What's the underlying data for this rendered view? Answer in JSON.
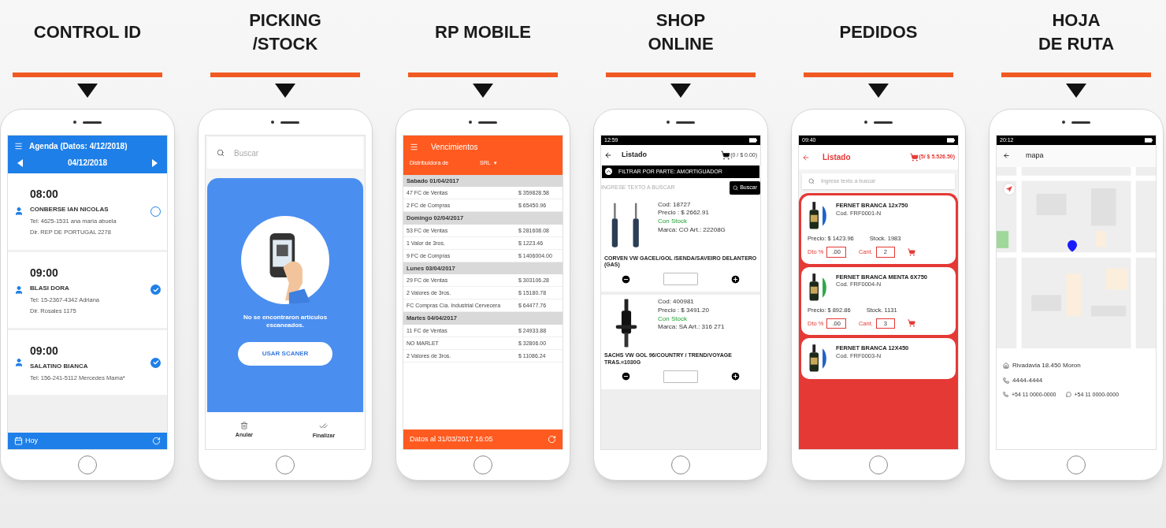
{
  "sections": [
    {
      "kind": "agenda",
      "title": "CONTROL ID",
      "screen": {
        "header_title": "Agenda (Datos: 4/12/2018)",
        "date": "04/12/2018",
        "appointments": [
          {
            "time": "08:00",
            "name": "CONBERSE IAN NICOLAS",
            "tel": "Tel: 4625-1531 ana maria abuela",
            "dir": "Dir. REP DE PORTUGAL 2278",
            "checked": false
          },
          {
            "time": "09:00",
            "name": "BLASI DORA",
            "tel": "Tel: 15-2367-4342 Adriana",
            "dir": "Dir. Rosales 1175",
            "checked": true
          },
          {
            "time": "09:00",
            "name": "SALATINO BIANCA",
            "tel": "Tel: 156-241-5112 Mercedes Mama*",
            "checked": true
          }
        ],
        "footer": "Hoy"
      }
    },
    {
      "kind": "picking",
      "title": "PICKING\n/STOCK",
      "screen": {
        "search_placeholder": "Buscar",
        "message": "No se encontraron artículos escaneados.",
        "button": "USAR SCANER",
        "actions": [
          "Anular",
          "Finalizar"
        ]
      }
    },
    {
      "kind": "vencimientos",
      "title": "RP MOBILE",
      "screen": {
        "title": "Vencimientos",
        "distributor_label": "Distribuidora de",
        "distributor_value": "SRL",
        "distributor_caret": "▾",
        "groups": [
          {
            "date": "Sabado 01/04/2017",
            "rows": [
              {
                "label": "47 FC de Ventas",
                "amount": "$ 359828.58"
              },
              {
                "label": "2 FC de Compras",
                "amount": "$ 65450.96"
              }
            ]
          },
          {
            "date": "Domingo 02/04/2017",
            "rows": [
              {
                "label": "53 FC de Ventas",
                "amount": "$ 281608.08"
              },
              {
                "label": "1 Valor de 3ros.",
                "amount": "$ 1223.46"
              },
              {
                "label": "9 FC de Compras",
                "amount": "$ 1406004.00"
              }
            ]
          },
          {
            "date": "Lunes 03/04/2017",
            "rows": [
              {
                "label": "29 FC de Ventas",
                "amount": "$ 303106.28"
              },
              {
                "label": "2 Valores de 3ros.",
                "amount": "$ 15180.78"
              },
              {
                "label": "FC Compras Cía. Industrial Cervecera",
                "amount": "$ 64477.76"
              }
            ]
          },
          {
            "date": "Martes 04/04/2017",
            "rows": [
              {
                "label": "11 FC de Ventas",
                "amount": "$ 24933.88"
              },
              {
                "label": "NO MARLET",
                "amount": "$ 32806.00"
              },
              {
                "label": "2 Valores de 3ros.",
                "amount": "$ 11086.24"
              }
            ]
          }
        ],
        "footer": "Datos al 31/03/2017 16:05"
      }
    },
    {
      "kind": "shop",
      "title": "SHOP\nONLINE",
      "screen": {
        "status_time": "12:59",
        "title": "Listado",
        "cart": "(0 / $ 0.00)",
        "filter": "FILTRAR POR PARTE: AMORTIGUADOR",
        "search_placeholder": "INGRESE TEXTO A BUSCAR",
        "search_button": "Buscar",
        "products": [
          {
            "code": "Cod: 18727",
            "price": "Precio : $ 2662.91",
            "stock": "Con Stock",
            "brand": "Marca: CO Art.: 22208G",
            "name": "CORVEN VW GACEL/GOL /SENDA/SAVEIRO DELANTERO (GAS)",
            "kind": "pair"
          },
          {
            "code": "Cod: 400981",
            "price": "Precio : $ 3491.20",
            "stock": "Con Stock",
            "brand": "Marca: SA Art.: 316 271",
            "name": "SACHS VW GOL 96/COUNTRY / TREND/VOYAGE TRAS.=1030G",
            "kind": "single"
          }
        ]
      }
    },
    {
      "kind": "pedidos",
      "title": "PEDIDOS",
      "screen": {
        "status_time": "09:40",
        "title": "Listado",
        "cart": "(5/ $ 5.526.50)",
        "search_placeholder": "Ingrese texto a buscar",
        "items": [
          {
            "name": "FERNET BRANCA 12x750",
            "code": "Cod. FRF0001-N",
            "price": "Precio: $ 1423.96",
            "stock": "Stock. 1983",
            "dto_label": "Dto %",
            "dto": ".00",
            "qty_label": "Cant.",
            "qty": "2",
            "color": "#1e63c8"
          },
          {
            "name": "FERNET BRANCA MENTA 6X750",
            "code": "Cod. FRF0004-N",
            "price": "Precio: $ 892.86",
            "stock": "Stock. 1131",
            "dto_label": "Dto %",
            "dto": ".00",
            "qty_label": "Cant.",
            "qty": "3",
            "color": "#2ea84a"
          },
          {
            "name": "FERNET BRANCA 12X450",
            "code": "Cod. FRF0003-N",
            "color": "#1e63c8"
          }
        ]
      }
    },
    {
      "kind": "mapa",
      "title": "HOJA\nDE RUTA",
      "screen": {
        "status_time": "20:12",
        "title": "mapa",
        "address": "Rivadavia 18.450 Moron",
        "phone": "4444-4444",
        "contacts": [
          "+54 11 0000-0000",
          "+54 11 0000-0000"
        ]
      }
    }
  ]
}
